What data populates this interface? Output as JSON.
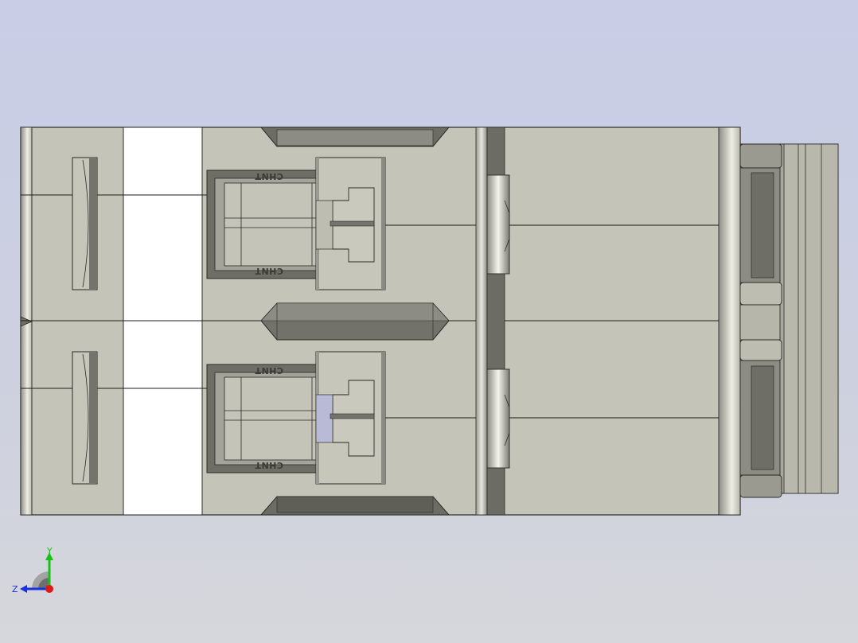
{
  "viewport": {
    "background_top": "#c9cde6",
    "background_bottom": "#d6d7dc"
  },
  "model": {
    "body_color": "#c4c4b9",
    "white_panel_color": "#ffffff",
    "dark_rail_color": "#6e6e66",
    "engraving": [
      "CHNT",
      "CHNT",
      "CHNT",
      "CHNT"
    ]
  },
  "triad": {
    "labels": {
      "y": "Y",
      "z": "Z"
    },
    "colors": {
      "x": "#e01818",
      "y": "#18c018",
      "z": "#1830e0"
    }
  }
}
